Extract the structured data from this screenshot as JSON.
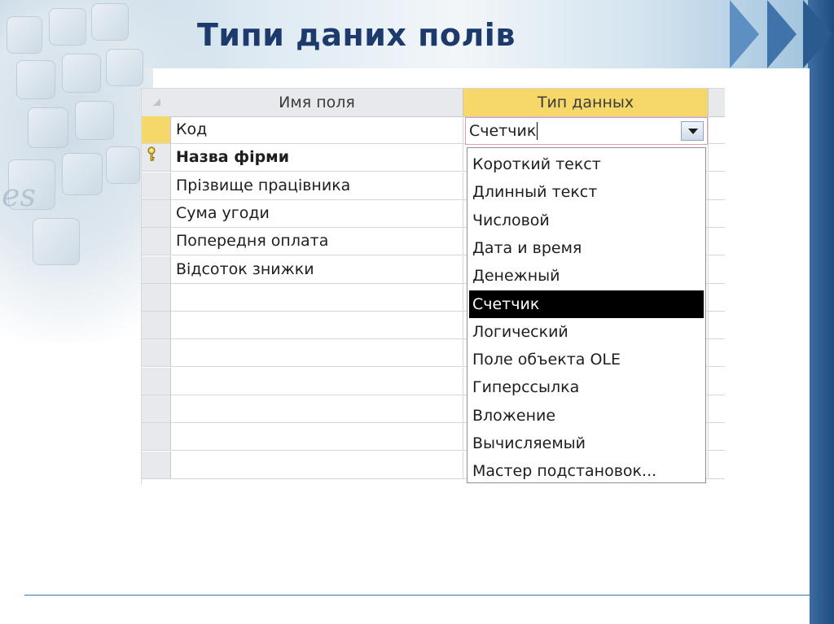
{
  "slide": {
    "title": "Типи даних полів"
  },
  "grid": {
    "header": {
      "field_name": "Имя поля",
      "data_type": "Тип данных"
    },
    "rows": [
      {
        "name": "Код"
      },
      {
        "name": "Назва фірми",
        "primary_key": true
      },
      {
        "name": "Прізвище працівника"
      },
      {
        "name": "Сума угоди"
      },
      {
        "name": "Попередня оплата"
      },
      {
        "name": "Відсоток знижки"
      },
      {
        "name": ""
      },
      {
        "name": ""
      },
      {
        "name": ""
      },
      {
        "name": ""
      },
      {
        "name": ""
      },
      {
        "name": ""
      },
      {
        "name": ""
      }
    ],
    "combo": {
      "value": "Счетчик"
    },
    "dropdown": {
      "selected": "Счетчик",
      "options": [
        "Короткий текст",
        "Длинный текст",
        "Числовой",
        "Дата и время",
        "Денежный",
        "Счетчик",
        "Логический",
        "Поле объекта OLE",
        "Гиперссылка",
        "Вложение",
        "Вычисляемый",
        "Мастер подстановок..."
      ]
    }
  },
  "colors": {
    "title": "#1c3b6c",
    "header_active": "#f6d86a",
    "highlight_bg": "#000000",
    "accent_bar": "#1f4d80"
  },
  "icons": [
    "primary-key-icon",
    "dropdown-arrow-icon",
    "select-all-triangle-icon"
  ]
}
